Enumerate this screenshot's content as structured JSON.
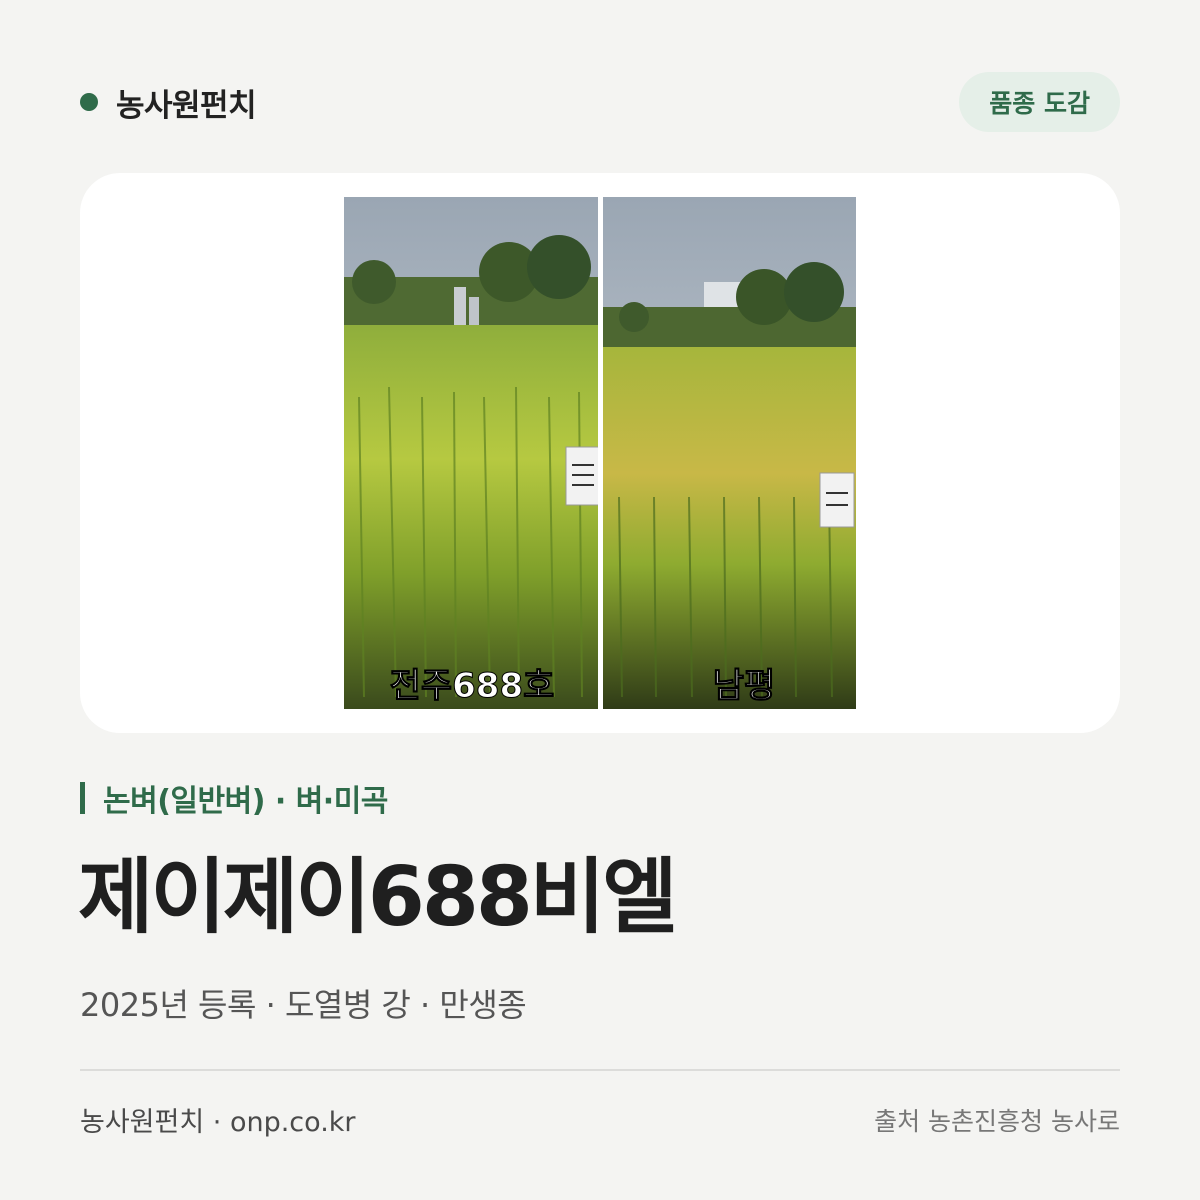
{
  "header": {
    "brand": "농사원펀치",
    "badge": "품종 도감"
  },
  "colors": {
    "accent": "#2f6b4a",
    "badge_bg": "#e5efe8",
    "background": "#f4f4f2",
    "card": "#ffffff"
  },
  "image": {
    "left_label": "전주688호",
    "right_label": "남평",
    "left_sign": "전주688호",
    "right_sign": "남평"
  },
  "variety": {
    "category": "논벼(일반벼) · 벼·미곡",
    "name": "제이제이688비엘",
    "meta": "2025년 등록 · 도열병 강 · 만생종"
  },
  "footer": {
    "site": "농사원펀치 · onp.co.kr",
    "source": "출처 농촌진흥청 농사로"
  }
}
